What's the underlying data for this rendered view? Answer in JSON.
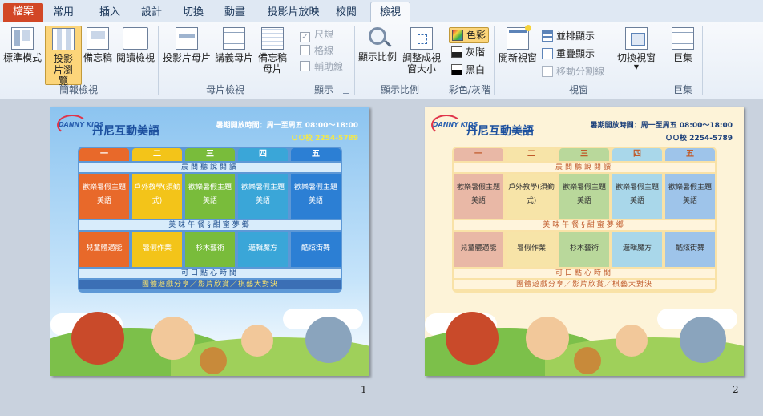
{
  "tabs": [
    "檔案",
    "常用",
    "插入",
    "設計",
    "切換",
    "動畫",
    "投影片放映",
    "校閱",
    "檢視"
  ],
  "active_tab": "檢視",
  "ribbon": {
    "groups": {
      "presentation_views": {
        "label": "簡報檢視",
        "buttons": [
          "標準模式",
          "投影片瀏覽",
          "備忘稿",
          "閱讀檢視"
        ],
        "selected": "投影片瀏覽"
      },
      "master_views": {
        "label": "母片檢視",
        "buttons": [
          "投影片母片",
          "講義母片",
          "備忘稿母片"
        ]
      },
      "show": {
        "label": "顯示",
        "items": [
          {
            "label": "尺規",
            "checked": true
          },
          {
            "label": "格線",
            "checked": false
          },
          {
            "label": "輔助線",
            "checked": false
          }
        ]
      },
      "zoom": {
        "label": "顯示比例",
        "buttons": [
          "顯示比例",
          "調整成視窗大小"
        ]
      },
      "color": {
        "label": "彩色/灰階",
        "items": [
          "色彩",
          "灰階",
          "黑白"
        ],
        "selected": "色彩"
      },
      "window": {
        "label": "視窗",
        "new_window": "開新視窗",
        "items": [
          "並排顯示",
          "重疊顯示",
          "移動分割線"
        ],
        "switch": "切換視窗"
      },
      "macros": {
        "label": "巨集",
        "button": "巨集"
      }
    }
  },
  "slide_content": {
    "brand": "丹尼互動美語",
    "logo": "DANNY KIDS",
    "hours": "暑期開放時間：周一至周五  08:00～18:00",
    "phone": "ＯＯ校 2254-5789",
    "days": [
      "一",
      "二",
      "三",
      "四",
      "五"
    ],
    "band1": "晨間聽說閱讀",
    "row1": [
      "歡樂暑假主題美語",
      "戶外教學(須勤式)",
      "歡樂暑假主題美語",
      "歡樂暑假主題美語",
      "歡樂暑假主題美語"
    ],
    "band2": "美味午餐§甜蜜夢鄉",
    "row2": [
      "兒童體適能",
      "暑假作業",
      "杉木藝術",
      "邏輯魔方",
      "酷炫街舞"
    ],
    "band3": "可口點心時間",
    "band4": "團體遊戲分享／影片欣賞／棋藝大對決"
  },
  "slide_numbers": [
    "1",
    "2"
  ],
  "colors": {
    "file_tab": "#d24726",
    "slide1_days": [
      "#e8692a",
      "#f3c419",
      "#79bc3b",
      "#3aa6d8",
      "#2c7fd4"
    ],
    "slide2_days": [
      "#e9b8a6",
      "#f7e4a8",
      "#b9d89b",
      "#a9d7ea",
      "#9ec4ea"
    ]
  }
}
